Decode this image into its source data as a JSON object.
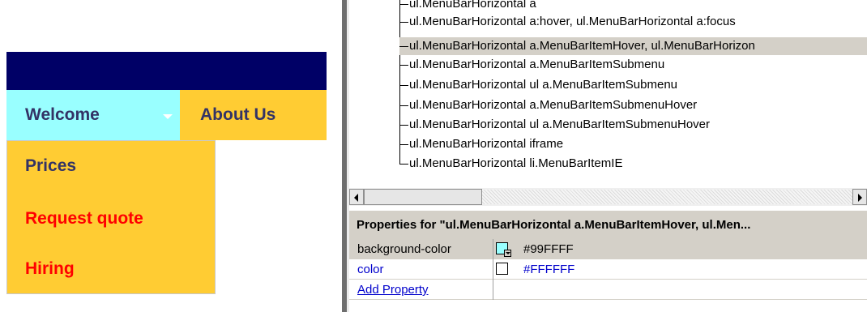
{
  "menu_preview": {
    "items": [
      {
        "label": "Welcome",
        "background": "#99FFFF"
      },
      {
        "label": "About Us",
        "background": "#FFCC33"
      }
    ],
    "topbar_color": "#000066",
    "submenu": [
      {
        "label": "Prices",
        "color": "#333366"
      },
      {
        "label": "Request quote",
        "color": "#FF0000"
      },
      {
        "label": "Hiring",
        "color": "#FF0000"
      }
    ]
  },
  "css_rules": [
    "ul.MenuBarHorizontal a",
    "ul.MenuBarHorizontal a:hover, ul.MenuBarHorizontal a:focus",
    "ul.MenuBarHorizontal a.MenuBarItemHover, ul.MenuBarHorizon",
    "ul.MenuBarHorizontal a.MenuBarItemSubmenu",
    "ul.MenuBarHorizontal ul a.MenuBarItemSubmenu",
    "ul.MenuBarHorizontal a.MenuBarItemSubmenuHover",
    "ul.MenuBarHorizontal ul a.MenuBarItemSubmenuHover",
    "ul.MenuBarHorizontal iframe",
    "ul.MenuBarHorizontal li.MenuBarItemIE"
  ],
  "selected_rule_index": 2,
  "properties": {
    "header": "Properties for \"ul.MenuBarHorizontal a.MenuBarItemHover, ul.Men...",
    "rows": [
      {
        "name": "background-color",
        "value": "#99FFFF",
        "swatch": "#99FFFF"
      },
      {
        "name": "color",
        "value": "#FFFFFF",
        "swatch": "#FFFFFF"
      }
    ],
    "add_property": "Add Property"
  }
}
